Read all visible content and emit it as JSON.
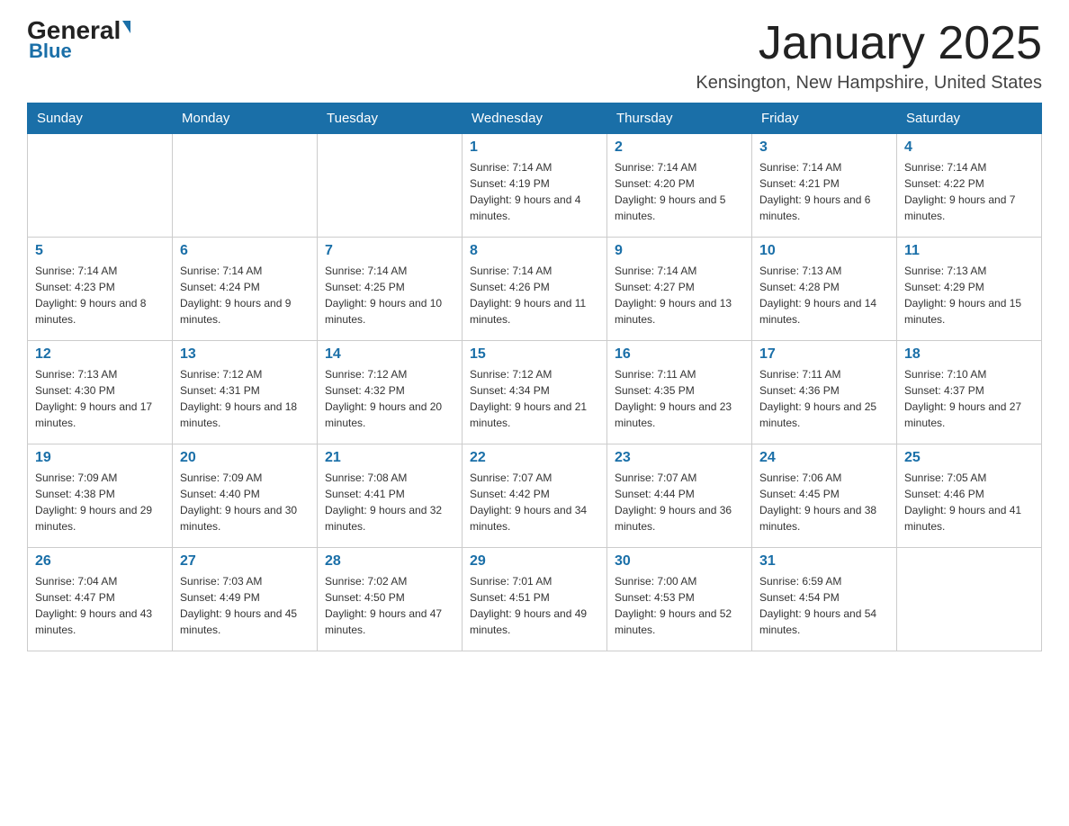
{
  "header": {
    "logo_general": "General",
    "logo_blue": "Blue",
    "month_title": "January 2025",
    "location": "Kensington, New Hampshire, United States"
  },
  "days_of_week": [
    "Sunday",
    "Monday",
    "Tuesday",
    "Wednesday",
    "Thursday",
    "Friday",
    "Saturday"
  ],
  "weeks": [
    {
      "cells": [
        {
          "day": "",
          "info": ""
        },
        {
          "day": "",
          "info": ""
        },
        {
          "day": "",
          "info": ""
        },
        {
          "day": "1",
          "info": "Sunrise: 7:14 AM\nSunset: 4:19 PM\nDaylight: 9 hours and 4 minutes."
        },
        {
          "day": "2",
          "info": "Sunrise: 7:14 AM\nSunset: 4:20 PM\nDaylight: 9 hours and 5 minutes."
        },
        {
          "day": "3",
          "info": "Sunrise: 7:14 AM\nSunset: 4:21 PM\nDaylight: 9 hours and 6 minutes."
        },
        {
          "day": "4",
          "info": "Sunrise: 7:14 AM\nSunset: 4:22 PM\nDaylight: 9 hours and 7 minutes."
        }
      ]
    },
    {
      "cells": [
        {
          "day": "5",
          "info": "Sunrise: 7:14 AM\nSunset: 4:23 PM\nDaylight: 9 hours and 8 minutes."
        },
        {
          "day": "6",
          "info": "Sunrise: 7:14 AM\nSunset: 4:24 PM\nDaylight: 9 hours and 9 minutes."
        },
        {
          "day": "7",
          "info": "Sunrise: 7:14 AM\nSunset: 4:25 PM\nDaylight: 9 hours and 10 minutes."
        },
        {
          "day": "8",
          "info": "Sunrise: 7:14 AM\nSunset: 4:26 PM\nDaylight: 9 hours and 11 minutes."
        },
        {
          "day": "9",
          "info": "Sunrise: 7:14 AM\nSunset: 4:27 PM\nDaylight: 9 hours and 13 minutes."
        },
        {
          "day": "10",
          "info": "Sunrise: 7:13 AM\nSunset: 4:28 PM\nDaylight: 9 hours and 14 minutes."
        },
        {
          "day": "11",
          "info": "Sunrise: 7:13 AM\nSunset: 4:29 PM\nDaylight: 9 hours and 15 minutes."
        }
      ]
    },
    {
      "cells": [
        {
          "day": "12",
          "info": "Sunrise: 7:13 AM\nSunset: 4:30 PM\nDaylight: 9 hours and 17 minutes."
        },
        {
          "day": "13",
          "info": "Sunrise: 7:12 AM\nSunset: 4:31 PM\nDaylight: 9 hours and 18 minutes."
        },
        {
          "day": "14",
          "info": "Sunrise: 7:12 AM\nSunset: 4:32 PM\nDaylight: 9 hours and 20 minutes."
        },
        {
          "day": "15",
          "info": "Sunrise: 7:12 AM\nSunset: 4:34 PM\nDaylight: 9 hours and 21 minutes."
        },
        {
          "day": "16",
          "info": "Sunrise: 7:11 AM\nSunset: 4:35 PM\nDaylight: 9 hours and 23 minutes."
        },
        {
          "day": "17",
          "info": "Sunrise: 7:11 AM\nSunset: 4:36 PM\nDaylight: 9 hours and 25 minutes."
        },
        {
          "day": "18",
          "info": "Sunrise: 7:10 AM\nSunset: 4:37 PM\nDaylight: 9 hours and 27 minutes."
        }
      ]
    },
    {
      "cells": [
        {
          "day": "19",
          "info": "Sunrise: 7:09 AM\nSunset: 4:38 PM\nDaylight: 9 hours and 29 minutes."
        },
        {
          "day": "20",
          "info": "Sunrise: 7:09 AM\nSunset: 4:40 PM\nDaylight: 9 hours and 30 minutes."
        },
        {
          "day": "21",
          "info": "Sunrise: 7:08 AM\nSunset: 4:41 PM\nDaylight: 9 hours and 32 minutes."
        },
        {
          "day": "22",
          "info": "Sunrise: 7:07 AM\nSunset: 4:42 PM\nDaylight: 9 hours and 34 minutes."
        },
        {
          "day": "23",
          "info": "Sunrise: 7:07 AM\nSunset: 4:44 PM\nDaylight: 9 hours and 36 minutes."
        },
        {
          "day": "24",
          "info": "Sunrise: 7:06 AM\nSunset: 4:45 PM\nDaylight: 9 hours and 38 minutes."
        },
        {
          "day": "25",
          "info": "Sunrise: 7:05 AM\nSunset: 4:46 PM\nDaylight: 9 hours and 41 minutes."
        }
      ]
    },
    {
      "cells": [
        {
          "day": "26",
          "info": "Sunrise: 7:04 AM\nSunset: 4:47 PM\nDaylight: 9 hours and 43 minutes."
        },
        {
          "day": "27",
          "info": "Sunrise: 7:03 AM\nSunset: 4:49 PM\nDaylight: 9 hours and 45 minutes."
        },
        {
          "day": "28",
          "info": "Sunrise: 7:02 AM\nSunset: 4:50 PM\nDaylight: 9 hours and 47 minutes."
        },
        {
          "day": "29",
          "info": "Sunrise: 7:01 AM\nSunset: 4:51 PM\nDaylight: 9 hours and 49 minutes."
        },
        {
          "day": "30",
          "info": "Sunrise: 7:00 AM\nSunset: 4:53 PM\nDaylight: 9 hours and 52 minutes."
        },
        {
          "day": "31",
          "info": "Sunrise: 6:59 AM\nSunset: 4:54 PM\nDaylight: 9 hours and 54 minutes."
        },
        {
          "day": "",
          "info": ""
        }
      ]
    }
  ]
}
